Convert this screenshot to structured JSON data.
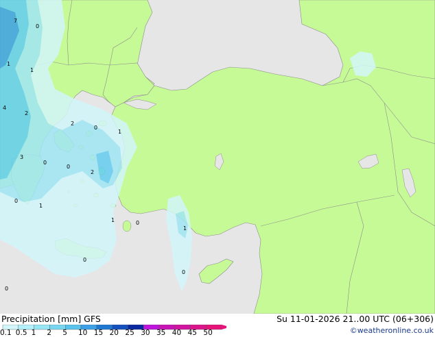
{
  "title": "Precipitation [mm] GFS",
  "valid_time": "Su 11-01-2026 21..00 UTC (06+306)",
  "credit": "©weatheronline.co.uk",
  "colors": {
    "sea": "#e6e6e6",
    "land": "#c6fa96",
    "border": "#8c8c8c",
    "precip_light": "#d2f6fa",
    "precip_mid": "#a0e6f5",
    "precip_heavy": "#64cdf0",
    "precip_max": "#3ca0e6"
  },
  "scale": {
    "ticks": [
      "0.1",
      "0.5",
      "1",
      "2",
      "5",
      "10",
      "15",
      "20",
      "25",
      "30",
      "35",
      "40",
      "45",
      "50"
    ],
    "colors": [
      "#d2f6fa",
      "#b4f0fa",
      "#96e6f5",
      "#78d7f0",
      "#5ac3eb",
      "#3ca0e6",
      "#1e78d2",
      "#1450be",
      "#0a28a0",
      "#be14dc",
      "#c814b4",
      "#d214a0",
      "#dc148c",
      "#e61478"
    ]
  },
  "map_labels": [
    "7",
    "0",
    "1",
    "1",
    "4",
    "2",
    "2",
    "0",
    "1",
    "3",
    "0",
    "0",
    "2",
    "0",
    "1",
    "1",
    "0",
    "1",
    "0",
    "0",
    "0"
  ]
}
